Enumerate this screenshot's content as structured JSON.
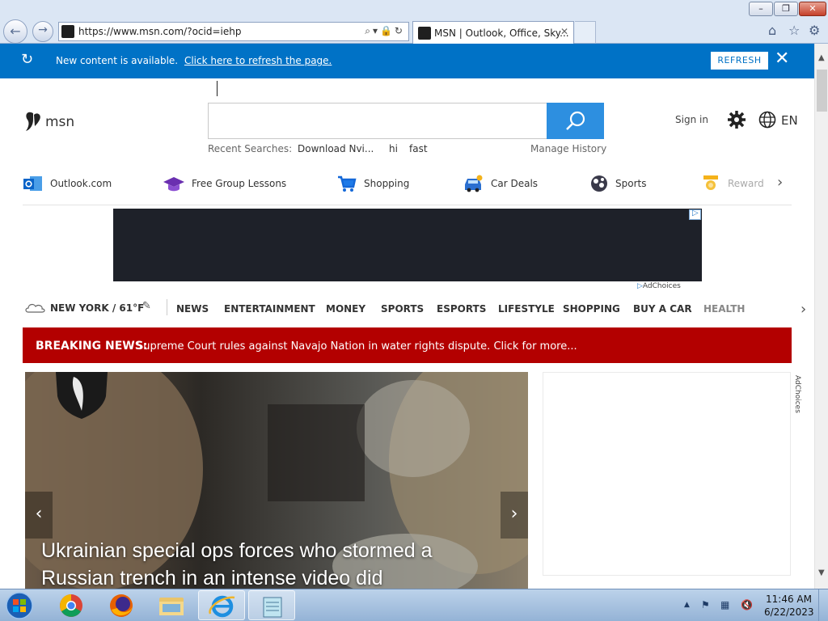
{
  "browser": {
    "url": "https://www.msn.com/?ocid=iehp",
    "tab_title": "MSN | Outlook, Office, Sky...",
    "tab_close": "✕",
    "window_buttons": {
      "minimize": "–",
      "maximize": "❐",
      "close": "✕"
    }
  },
  "notification": {
    "text": "New content is available.",
    "link": "Click here to refresh the page.",
    "refresh_label": "REFRESH",
    "close": "✕"
  },
  "header": {
    "logo_text": "msn",
    "recent_label": "Recent Searches:",
    "recent_items": [
      "Download Nvi...",
      "hi",
      "fast"
    ],
    "manage_history": "Manage History",
    "signin": "Sign in",
    "language": "EN"
  },
  "quicklinks": [
    {
      "label": "Outlook.com",
      "icon": "outlook-icon"
    },
    {
      "label": "Free Group Lessons",
      "icon": "graduation-cap-icon"
    },
    {
      "label": "Shopping",
      "icon": "shopping-cart-icon"
    },
    {
      "label": "Car Deals",
      "icon": "car-icon"
    },
    {
      "label": "Sports",
      "icon": "sports-ball-icon"
    },
    {
      "label": "Rewards",
      "icon": "trophy-icon"
    }
  ],
  "ad": {
    "adchoices": "AdChoices"
  },
  "weather": {
    "text": "NEW YORK / 61°F"
  },
  "categories": [
    "NEWS",
    "ENTERTAINMENT",
    "MONEY",
    "SPORTS",
    "ESPORTS",
    "LIFESTYLE",
    "SHOPPING",
    "BUY A CAR",
    "HEALTH"
  ],
  "breaking": {
    "label": "BREAKING NEWS:",
    "text": "Supreme Court rules against Navajo Nation in water rights dispute. Click for more..."
  },
  "hero": {
    "title": "Ukrainian special ops forces who stormed a Russian trench in an intense video did"
  },
  "taskbar": {
    "time": "11:46 AM",
    "date": "6/22/2023"
  },
  "colors": {
    "accent": "#0072c6",
    "search_button": "#2d8fe0",
    "breaking": "#b30000"
  }
}
